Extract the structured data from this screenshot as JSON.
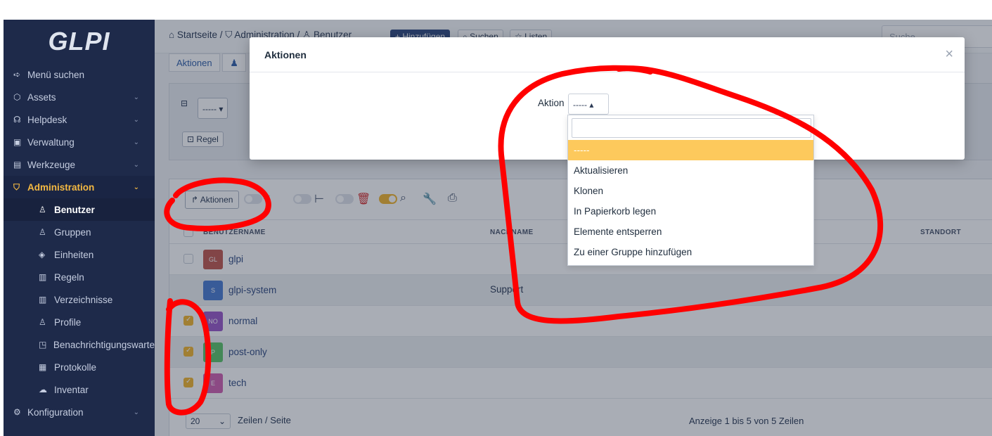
{
  "sidebar": {
    "logo": "GLPI",
    "menu_search": "Menü suchen",
    "items": [
      {
        "label": "Assets"
      },
      {
        "label": "Helpdesk"
      },
      {
        "label": "Verwaltung"
      },
      {
        "label": "Werkzeuge"
      },
      {
        "label": "Administration"
      }
    ],
    "sub_items": [
      {
        "label": "Benutzer"
      },
      {
        "label": "Gruppen"
      },
      {
        "label": "Einheiten"
      },
      {
        "label": "Regeln"
      },
      {
        "label": "Verzeichnisse"
      },
      {
        "label": "Profile"
      },
      {
        "label": "Benachrichtigungswarte"
      },
      {
        "label": "Protokolle"
      },
      {
        "label": "Inventar"
      }
    ],
    "config": "Konfiguration"
  },
  "header": {
    "breadcrumb_home": "Startseite",
    "breadcrumb_admin": "Administration",
    "breadcrumb_users": "Benutzer",
    "add_label": "+ Hinzufügen",
    "search_label": "Suchen",
    "lists_label": "Listen",
    "search_placeholder": "Suche"
  },
  "tabs": {
    "aktionen": "Aktionen"
  },
  "panel": {
    "select_value": "----- ▾",
    "regel_label": "Regel"
  },
  "list": {
    "aktionen_label": "Aktionen",
    "columns": {
      "username": "BENUTZERNAME",
      "lastname": "NACHNAME",
      "location": "STANDORT"
    },
    "rows": [
      {
        "initials": "GL",
        "name": "glpi",
        "lastname": "",
        "checked": false,
        "avatar_color": "#c0584e"
      },
      {
        "initials": "S",
        "name": "glpi-system",
        "lastname": "Support",
        "checked": false,
        "avatar_color": "#4a7bd0"
      },
      {
        "initials": "NO",
        "name": "normal",
        "lastname": "",
        "checked": true,
        "avatar_color": "#9a57c9"
      },
      {
        "initials": "P",
        "name": "post-only",
        "lastname": "",
        "checked": true,
        "avatar_color": "#5bc468"
      },
      {
        "initials": "E",
        "name": "tech",
        "lastname": "",
        "checked": true,
        "avatar_color": "#d160b0"
      }
    ],
    "per_page_value": "20",
    "per_page_label": "Zeilen / Seite",
    "page_info": "Anzeige 1 bis 5 von 5 Zeilen"
  },
  "modal": {
    "title": "Aktionen",
    "close": "×",
    "aktion_label": "Aktion",
    "select_value": "----- ▴",
    "options": [
      "-----",
      "Aktualisieren",
      "Klonen",
      "In Papierkorb legen",
      "Elemente entsperren",
      "Zu einer Gruppe hinzufügen"
    ]
  },
  "colors": {
    "accent": "#f2b52e",
    "sidebar_bg": "#1e2a4a",
    "annotation": "#ff0000"
  }
}
